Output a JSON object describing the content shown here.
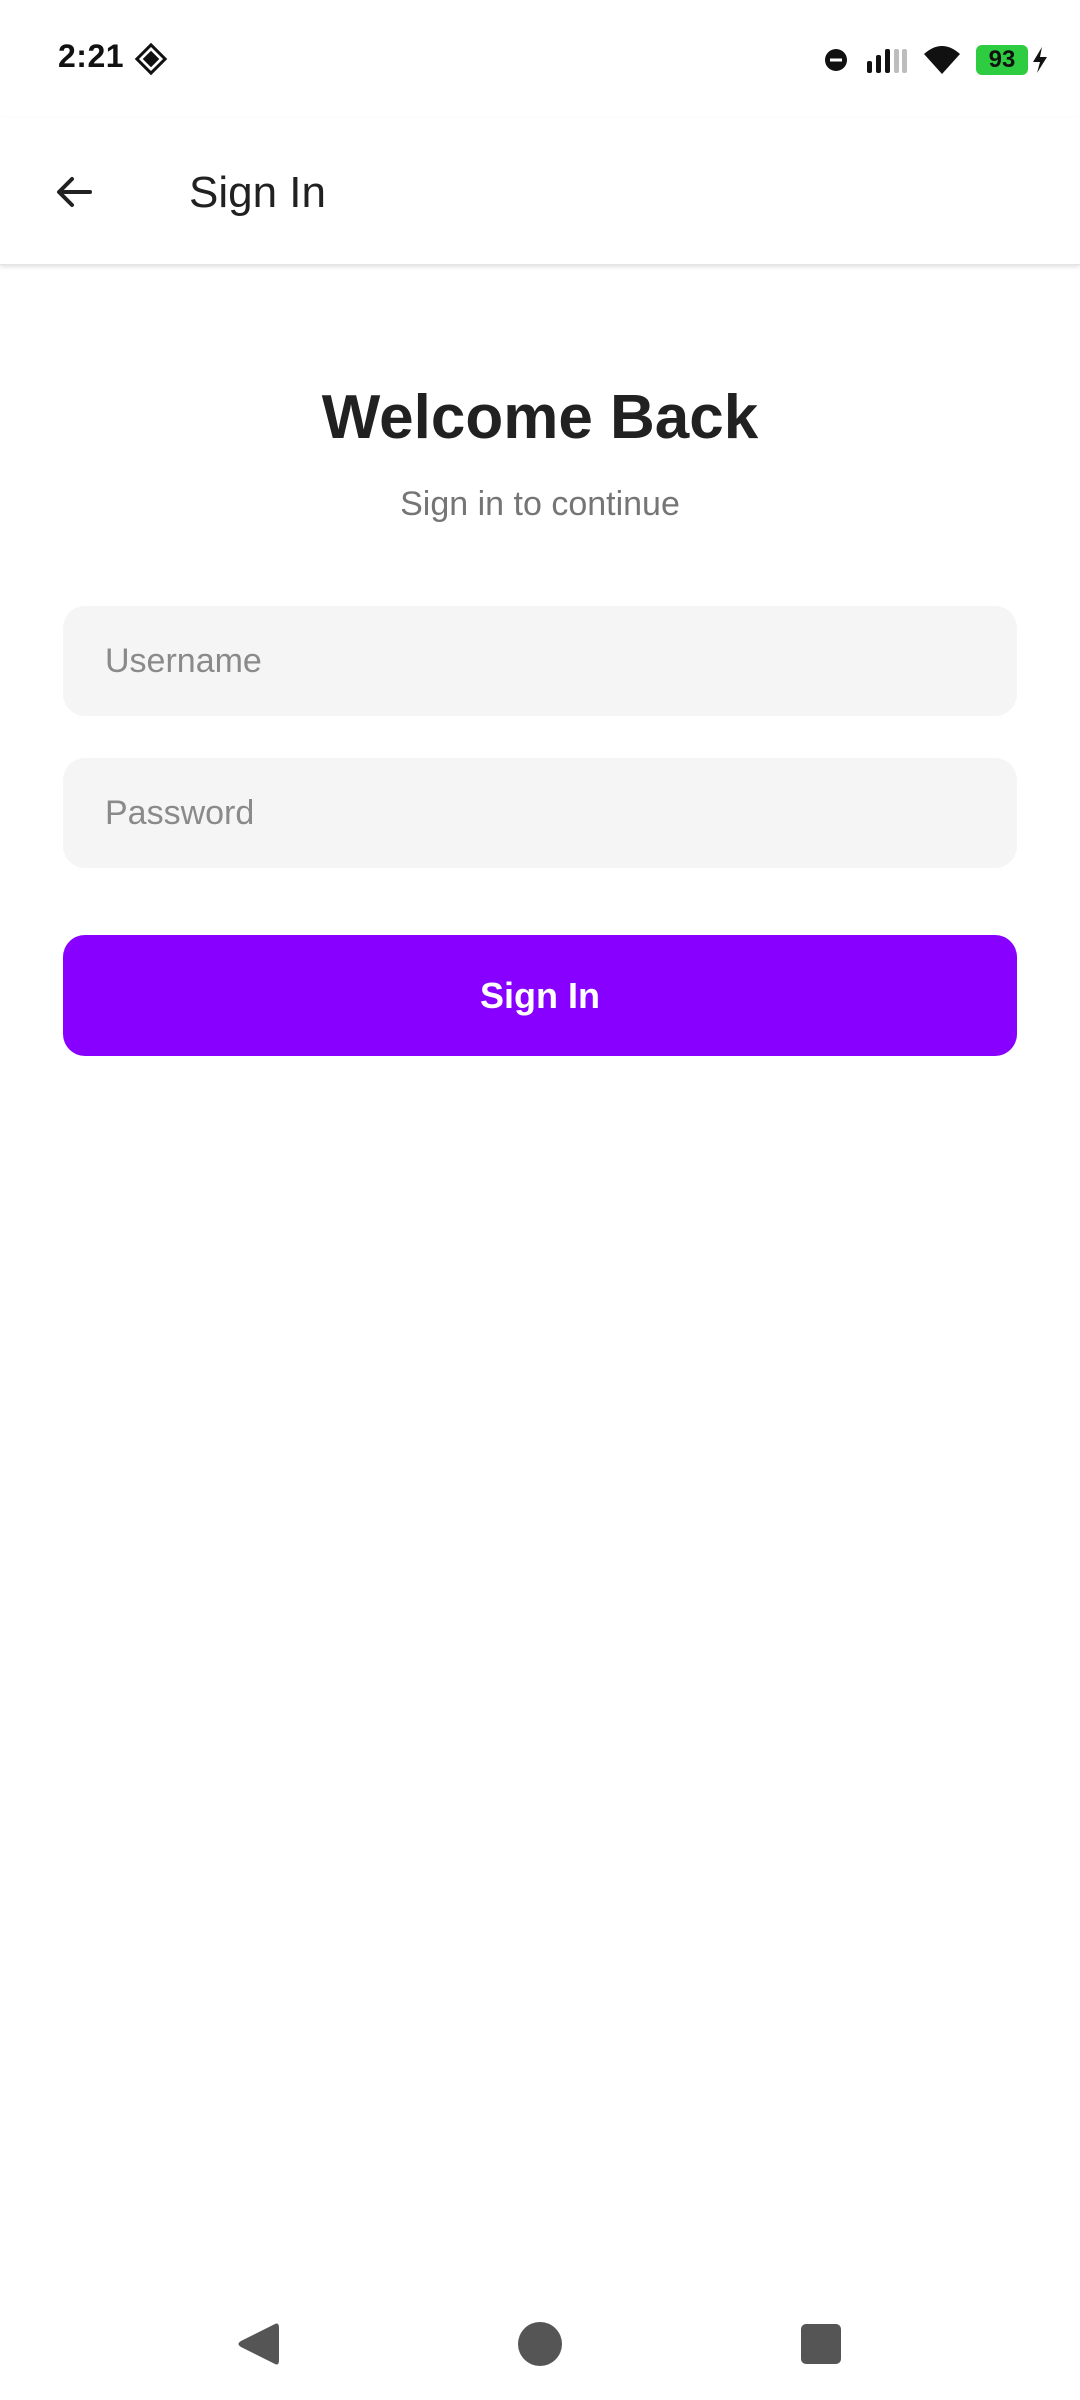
{
  "status_bar": {
    "time": "2:21",
    "battery_level": "93",
    "battery_color": "#2ecc40",
    "icons": [
      "navigation-app-icon",
      "do-not-disturb-icon",
      "signal-icon",
      "wifi-icon",
      "battery-icon",
      "charging-bolt-icon"
    ]
  },
  "app_bar": {
    "title": "Sign In",
    "back_icon": "arrow-back-icon"
  },
  "main": {
    "title": "Welcome Back",
    "subtitle": "Sign in to continue",
    "username": {
      "placeholder": "Username",
      "value": ""
    },
    "password": {
      "placeholder": "Password",
      "value": ""
    },
    "sign_in_button_label": "Sign In",
    "accent_color": "#8800ff"
  },
  "nav_bar": {
    "icons": [
      "nav-back-icon",
      "nav-home-icon",
      "nav-recents-icon"
    ]
  }
}
